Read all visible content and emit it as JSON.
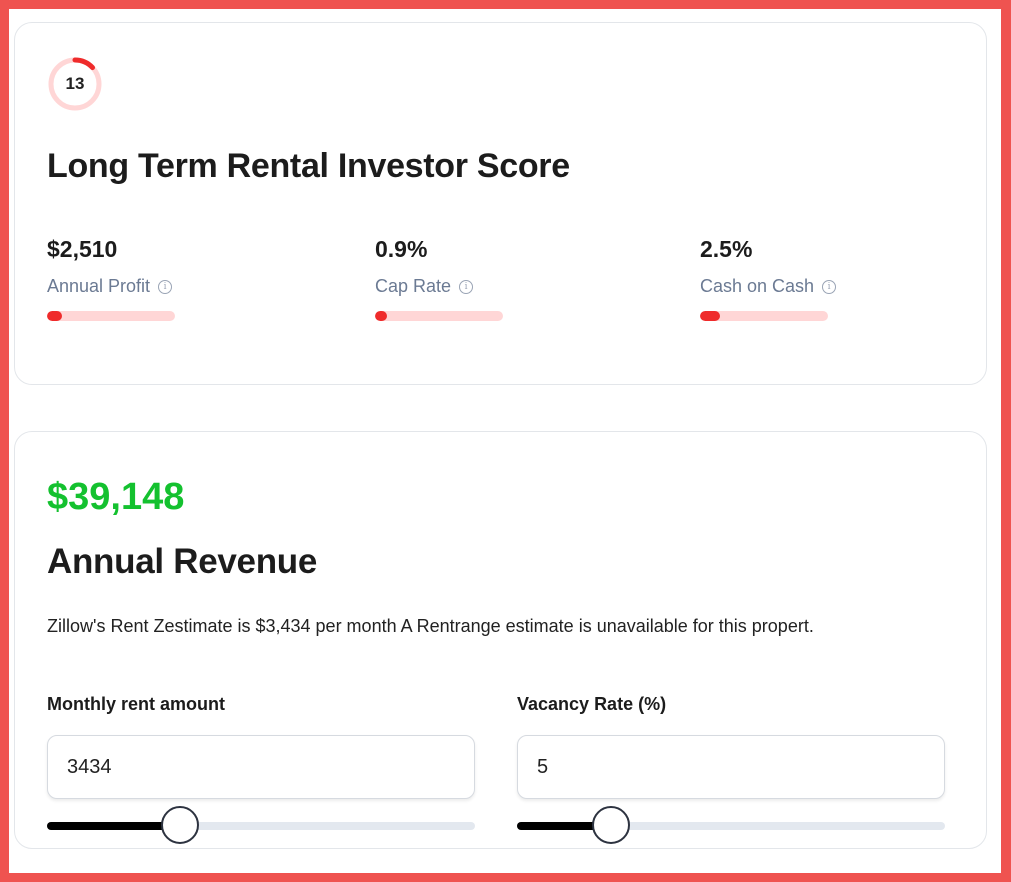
{
  "score": {
    "value": "13",
    "fraction": 0.13,
    "title": "Long Term Rental Investor Score"
  },
  "metrics": [
    {
      "value": "$2,510",
      "label": "Annual Profit",
      "info_icon": "info-icon",
      "level": 0.12
    },
    {
      "value": "0.9%",
      "label": "Cap Rate",
      "info_icon": "info-icon",
      "level": 0.09
    },
    {
      "value": "2.5%",
      "label": "Cash on Cash",
      "info_icon": "info-icon",
      "level": 0.16
    }
  ],
  "revenue": {
    "amount": "$39,148",
    "title": "Annual Revenue",
    "description": "Zillow's Rent Zestimate is $3,434 per month A Rentrange estimate is unavailable for this propert."
  },
  "fields": [
    {
      "label": "Monthly rent amount",
      "value": "3434",
      "slider_level": 0.31
    },
    {
      "label": "Vacancy Rate (%)",
      "value": "5",
      "slider_level": 0.22
    }
  ],
  "colors": {
    "frame": "#ef5350",
    "accent_red": "#ef2b2b",
    "bar_track": "#ffd6d6",
    "revenue_green": "#14c12f",
    "label_gray": "#6b7a93"
  },
  "info_glyph": "i"
}
